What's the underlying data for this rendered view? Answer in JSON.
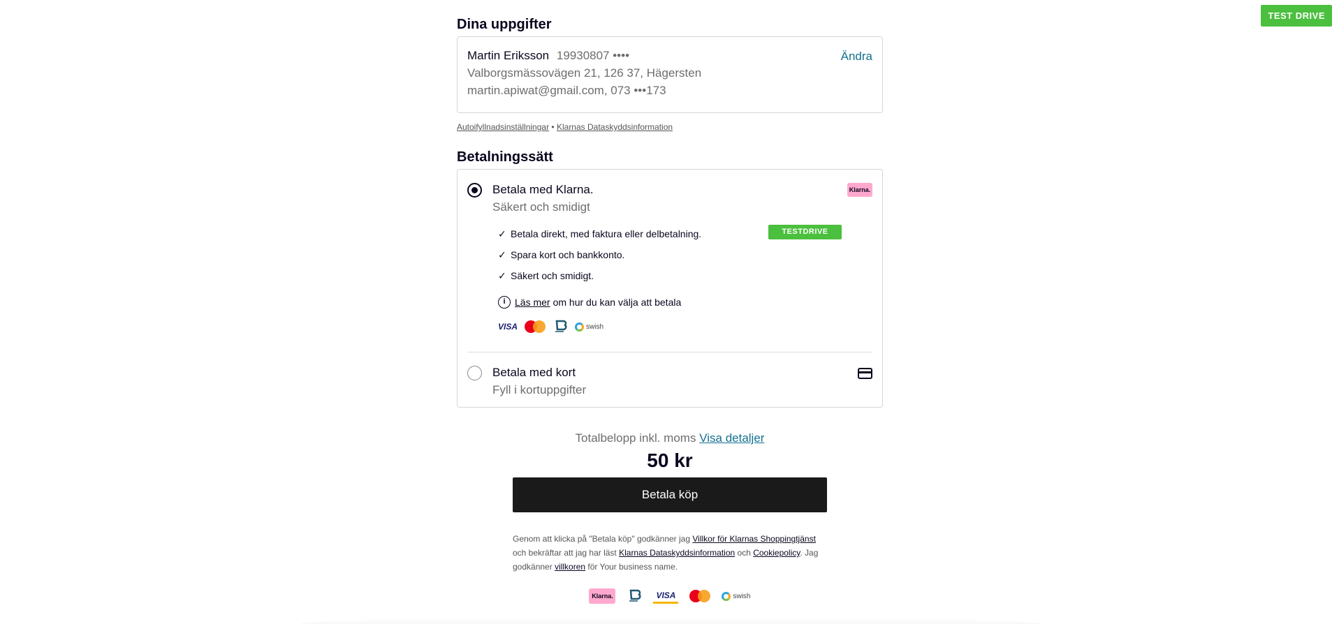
{
  "badge": {
    "test_drive": "TEST DRIVE"
  },
  "details": {
    "title": "Dina uppgifter",
    "name": "Martin Eriksson",
    "personal_number": "19930807 ••••",
    "address": "Valborgsmässovägen 21, 126 37, Hägersten",
    "contact": "martin.apiwat@gmail.com, 073 •••173",
    "change_label": "Ändra"
  },
  "info_links": {
    "autofill": "Autoifyllnadsinställningar",
    "separator": "•",
    "privacy": "Klarnas Dataskyddsinformation"
  },
  "payment": {
    "title": "Betalningssätt",
    "klarna_option": {
      "title": "Betala med Klarna.",
      "subtitle": "Säkert och smidigt",
      "logo_text": "Klarna.",
      "testdrive_tag": "TESTDRIVE",
      "bullets": [
        "Betala direkt, med faktura eller delbetalning.",
        "Spara kort och bankkonto.",
        "Säkert och smidigt."
      ],
      "read_more_link": "Läs mer",
      "read_more_text": "om hur du kan välja att betala",
      "logos": {
        "visa": "VISA",
        "swish": "swish"
      }
    },
    "card_option": {
      "title": "Betala med kort",
      "subtitle": "Fyll i kortuppgifter"
    }
  },
  "summary": {
    "total_label": "Totalbelopp inkl. moms",
    "details_link": "Visa detaljer",
    "amount": "50 kr",
    "pay_button": "Betala köp"
  },
  "terms": {
    "t1": "Genom att klicka på \"Betala köp\" godkänner jag",
    "l1": "Villkor för Klarnas Shoppingtjänst",
    "t2": "och bekräftar att jag har läst",
    "l2": "Klarnas Dataskyddsinformation",
    "t3": "och",
    "l3": "Cookiepolicy",
    "t4": ". Jag godkänner",
    "l4": "villkoren",
    "t5": "för Your business name."
  },
  "footer_logos": {
    "klarna": "Klarna.",
    "visa": "VISA"
  },
  "colors": {
    "green": "#4bbf3e",
    "link": "#14708f",
    "klarna_pink": "#ffa8cd",
    "button": "#1a1a1a"
  }
}
